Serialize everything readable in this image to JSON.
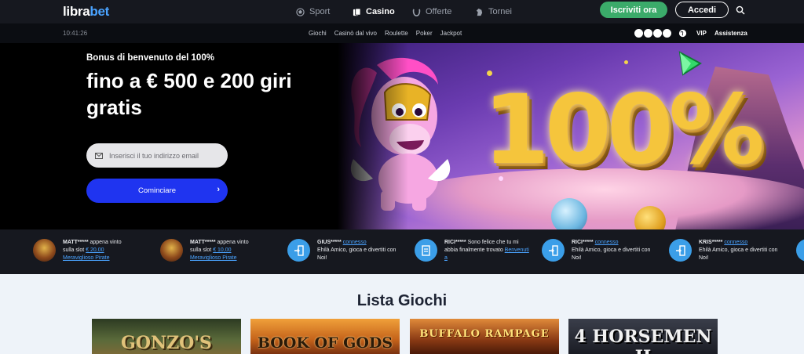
{
  "header": {
    "logo_part1": "libra",
    "logo_part2": "bet",
    "nav": [
      {
        "label": "Sport",
        "icon": "soccer-ball-icon"
      },
      {
        "label": "Casino",
        "icon": "cards-icon"
      },
      {
        "label": "Offerte",
        "icon": "horseshoe-icon"
      },
      {
        "label": "Tornei",
        "icon": "tornament-icon"
      }
    ],
    "signup_label": "Iscriviti ora",
    "login_label": "Accedi"
  },
  "subbar": {
    "time": "10:41:26",
    "links": [
      "Giochi",
      "Casinò dal vivo",
      "Roulette",
      "Poker",
      "Jackpot"
    ],
    "vip": "VIP",
    "assistance": "Assistenza"
  },
  "hero": {
    "subtitle": "Bonus di benvenuto del 100%",
    "title": "fino a € 500 e 200 giri gratis",
    "email_placeholder": "Inserisci il tuo indirizzo email",
    "start_label": "Cominciare",
    "banner_text": "100%"
  },
  "ticker": [
    {
      "kind": "slot",
      "user": "MATT*****",
      "line1": " appena vinto",
      "line2": "sulla slot ",
      "amount": "€ 20,00",
      "link": "Meraviglioso Pirate"
    },
    {
      "kind": "slot",
      "user": "MATT*****",
      "line1": " appena vinto",
      "line2": "sulla slot ",
      "amount": "€ 10,00",
      "link": "Meraviglioso Pirate"
    },
    {
      "kind": "login",
      "user": "GIUS*****",
      "status": "connesso",
      "msg": "Ehilà Amico, gioca e divertiti con Noi!"
    },
    {
      "kind": "signup",
      "user": "RICI*****",
      "msg1": " Sono felice che tu mi abbia finalmente trovato",
      "link": "Benvenuti a"
    },
    {
      "kind": "login",
      "user": "RICI*****",
      "status": "connesso",
      "msg": "Ehilà Amico, gioca e divertiti con Noi!"
    },
    {
      "kind": "login",
      "user": "KRIS*****",
      "status": "connesso",
      "msg": "Ehilà Amico, gioca e divertiti con Noi!"
    }
  ],
  "games": {
    "title": "Lista Giochi",
    "cards": [
      "GONZO'S",
      "BOOK OF GODS",
      "BUFFALO RAMPAGE",
      "4 HORSEMEN II"
    ]
  },
  "colors": {
    "brand_blue": "#4aa3ff",
    "signup_green": "#3bab6a",
    "start_blue": "#1f34f0"
  }
}
